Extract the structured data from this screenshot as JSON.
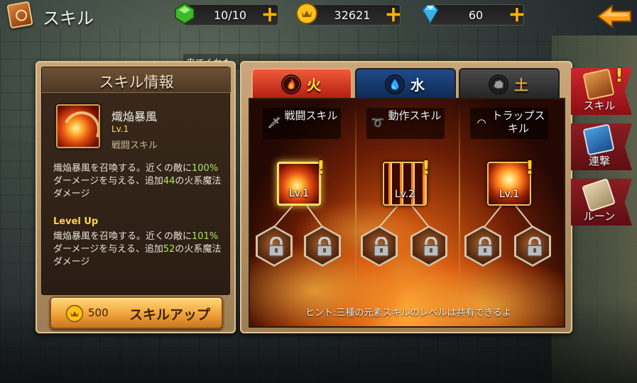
{
  "header": {
    "title": "スキル",
    "resources": [
      {
        "name": "stamina",
        "value": "10/10",
        "icon": "green-gem-icon",
        "color": "#5cd13a"
      },
      {
        "name": "gold",
        "value": "32621",
        "icon": "gold-coin-icon",
        "color": "#ffc21a"
      },
      {
        "name": "gems",
        "value": "60",
        "icon": "diamond-icon",
        "color": "#5fd8ff"
      }
    ],
    "plus_label": "+",
    "back_icon": "back-arrow-icon"
  },
  "toast": "来てくれた",
  "info_panel": {
    "title": "スキル情報",
    "skill_name": "熾焔暴風",
    "skill_level": "Lv.1",
    "skill_type": "戦闘スキル",
    "desc_segments": [
      {
        "t": "熾焔暴風を召喚する。近くの敵に",
        "hl": false
      },
      {
        "t": "100%",
        "hl": true
      },
      {
        "t": "ダーメージを与える、追加",
        "hl": false
      },
      {
        "t": "44",
        "hl": true
      },
      {
        "t": "の火系魔法ダメージ",
        "hl": false
      }
    ],
    "levelup_label": "Level Up",
    "levelup_segments": [
      {
        "t": "熾焔暴風を召喚する。近くの敵に",
        "hl": false
      },
      {
        "t": "101%",
        "hl": true
      },
      {
        "t": "ダーメージを与える、追加",
        "hl": false
      },
      {
        "t": "52",
        "hl": true
      },
      {
        "t": "の火系魔法ダメージ",
        "hl": false
      }
    ],
    "upgrade_cost": "500",
    "upgrade_label": "スキルアップ"
  },
  "tabs": [
    {
      "label": "火",
      "icon": "fire-icon",
      "active": true
    },
    {
      "label": "水",
      "icon": "water-drop-icon",
      "active": false
    },
    {
      "label": "土",
      "icon": "rock-icon",
      "active": false
    }
  ],
  "columns": [
    {
      "label": "戦闘スキル",
      "icon": "sword-icon",
      "node_level": "Lv.1",
      "selected": true
    },
    {
      "label": "動作スキル",
      "icon": "dash-icon",
      "node_level": "Lv.2",
      "selected": false
    },
    {
      "label": "トラップスキル",
      "icon": "trap-icon",
      "node_level": "Lv.1",
      "selected": false
    }
  ],
  "hint": "ヒント:三種の元素スキルのレベルは共有できるよ",
  "side_tabs": [
    {
      "label": "スキル",
      "icon": "skill-book-icon",
      "active": true
    },
    {
      "label": "連撃",
      "icon": "combo-book-icon",
      "active": false
    },
    {
      "label": "ルーン",
      "icon": "rune-scroll-icon",
      "active": false
    }
  ],
  "colors": {
    "highlight_number": "#a9e85c",
    "level_text": "#ffdd45",
    "fire_tab": "#c0281a",
    "water_tab": "#1a3f78",
    "earth_tab": "#333333"
  }
}
